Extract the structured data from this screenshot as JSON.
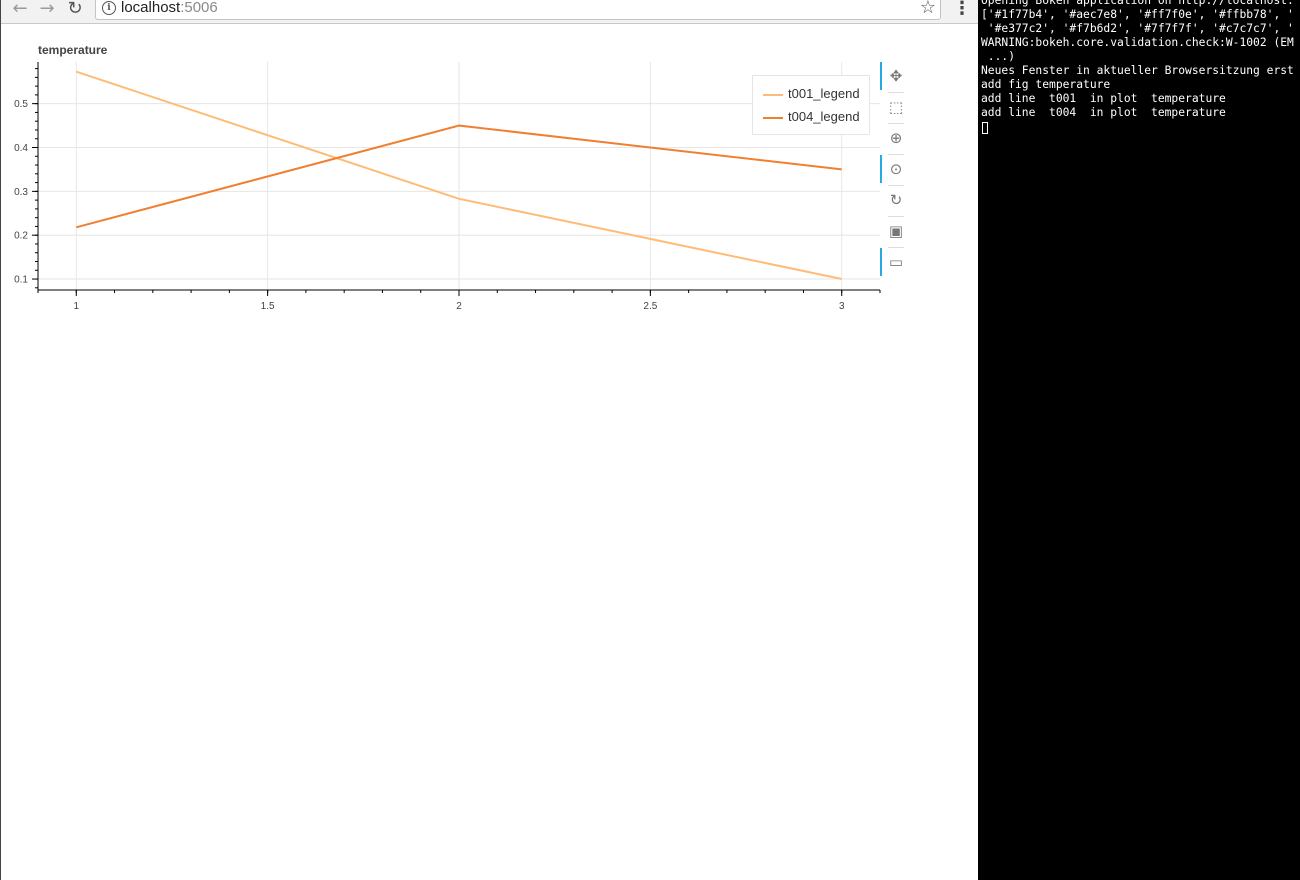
{
  "browser": {
    "nav": {
      "back": "←",
      "forward": "→",
      "reload": "↻"
    },
    "url_host": "localhost",
    "url_port": ":5006",
    "star": "☆",
    "menu": "⋮",
    "icons": [
      "back-arrow-icon",
      "forward-arrow-icon",
      "reload-icon",
      "info-icon",
      "star-icon",
      "more-vert-icon"
    ]
  },
  "tools": {
    "icons": [
      "pan-icon",
      "box-zoom-icon",
      "wheel-zoom-icon",
      "zoom-in-icon",
      "reset-icon",
      "save-icon",
      "hover-icon"
    ],
    "glyphs": [
      "✥",
      "⬚",
      "⊕",
      "⊙",
      "↻",
      "▣",
      "▭"
    ]
  },
  "chart_data": {
    "type": "line",
    "title": "temperature",
    "xlabel": "",
    "ylabel": "",
    "xlim": [
      0.9,
      3.1
    ],
    "ylim": [
      0.075,
      0.595
    ],
    "x_ticks": [
      "1",
      "1.5",
      "2",
      "2.5",
      "3"
    ],
    "y_ticks": [
      "0.1",
      "0.2",
      "0.3",
      "0.4",
      "0.5"
    ],
    "grid": true,
    "legend_position": "top-right",
    "series": [
      {
        "name": "t001_legend",
        "color": "#ffbb78",
        "x": [
          1,
          2,
          3
        ],
        "y": [
          0.573,
          0.283,
          0.1
        ]
      },
      {
        "name": "t004_legend",
        "color": "#f07f30",
        "x": [
          1,
          2,
          3
        ],
        "y": [
          0.218,
          0.45,
          0.35
        ]
      }
    ]
  },
  "terminal": {
    "lines": [
      "Opening Bokeh application on http://localhost:",
      "['#1f77b4', '#aec7e8', '#ff7f0e', '#ffbb78', '",
      " '#e377c2', '#f7b6d2', '#7f7f7f', '#c7c7c7', '",
      "WARNING:bokeh.core.validation.check:W-1002 (EM",
      " ...)",
      "Neues Fenster in aktueller Browsersitzung erst",
      "add fig temperature",
      "add line  t001  in plot  temperature",
      "add line  t004  in plot  temperature"
    ]
  }
}
